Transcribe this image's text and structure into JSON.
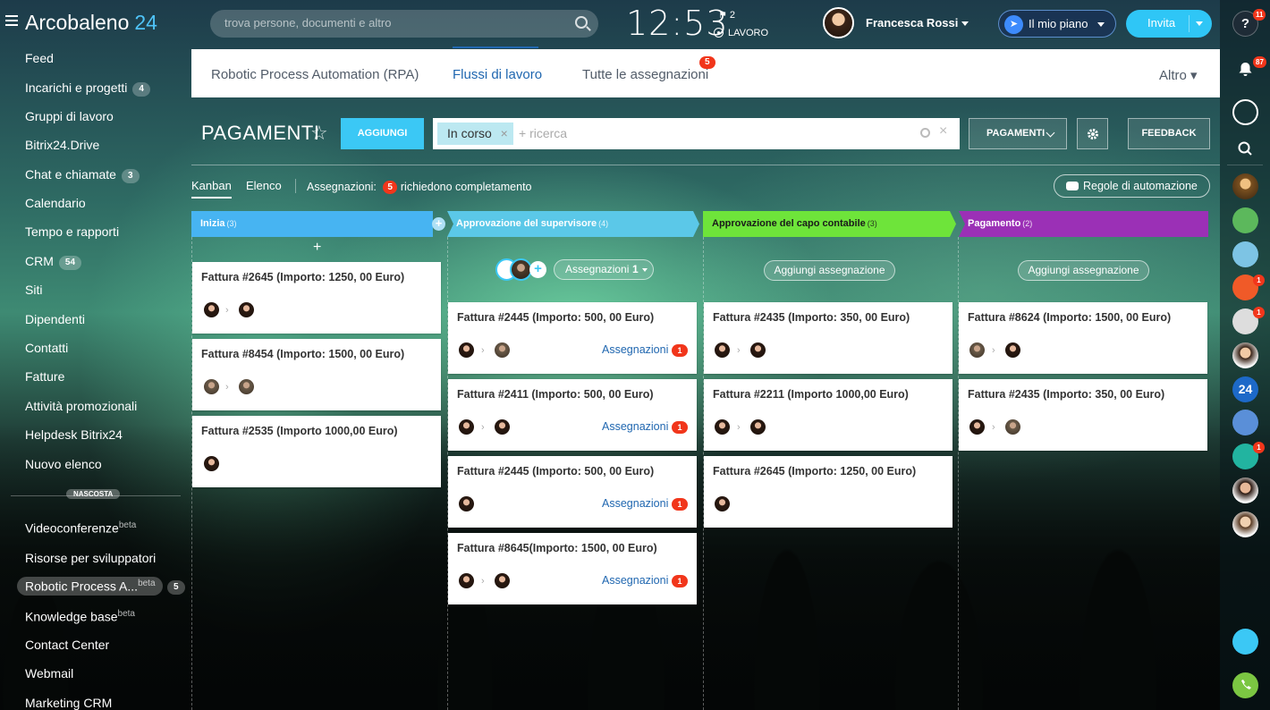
{
  "header": {
    "logo_text": "Arcobaleno",
    "logo_number": "24",
    "search_placeholder": "trova persone, documenti e altro",
    "clock": "12:53",
    "flag_count": "2",
    "work_status": "LAVORO",
    "user_name": "Francesca Rossi",
    "plan_label": "Il mio piano",
    "invite_label": "Invita"
  },
  "sidebar": {
    "items": [
      {
        "label": "Feed"
      },
      {
        "label": "Incarichi e progetti",
        "count": "4"
      },
      {
        "label": "Gruppi di lavoro"
      },
      {
        "label": "Bitrix24.Drive"
      },
      {
        "label": "Chat e chiamate",
        "count": "3"
      },
      {
        "label": "Calendario"
      },
      {
        "label": "Tempo e rapporti"
      },
      {
        "label": "CRM",
        "count": "54"
      },
      {
        "label": "Siti"
      },
      {
        "label": "Dipendenti"
      },
      {
        "label": "Contatti"
      },
      {
        "label": "Fatture"
      },
      {
        "label": "Attività promozionali"
      },
      {
        "label": "Helpdesk Bitrix24"
      },
      {
        "label": "Nuovo elenco"
      }
    ],
    "hidden_label": "NASCOSTA",
    "hidden_items": [
      {
        "label": "Videoconferenze",
        "sup": "beta"
      },
      {
        "label": "Risorse per sviluppatori"
      },
      {
        "label": "Robotic Process A...",
        "sup": "beta",
        "count": "5"
      },
      {
        "label": "Knowledge base",
        "sup": "beta"
      },
      {
        "label": "Contact Center"
      },
      {
        "label": "Webmail"
      },
      {
        "label": "Marketing CRM"
      }
    ]
  },
  "rail": {
    "help_badge": "11",
    "notif_badge": "87",
    "badges": [
      "1",
      "1",
      "1"
    ],
    "b24_label": "24"
  },
  "tabs": {
    "items": [
      "Robotic Process Automation (RPA)",
      "Flussi di lavoro",
      "Tutte le assegnazioni"
    ],
    "active": "Flussi di lavoro",
    "assignments_badge": "5",
    "more": "Altro"
  },
  "toolbar": {
    "title": "PAGAMENTI",
    "add_label": "AGGIUNGI",
    "filter_chip": "In corso",
    "filter_placeholder": "+ ricerca",
    "preset_label": "PAGAMENTI",
    "feedback_label": "FEEDBACK"
  },
  "views": {
    "kanban": "Kanban",
    "list": "Elenco",
    "assignments_prefix": "Assegnazioni:",
    "assignments_count": "5",
    "assignments_suffix": "richiedono completamento",
    "automation_label": "Regole di automazione"
  },
  "kanban": {
    "assign_link": "Assegnazioni",
    "add_assignment": "Aggiungi assegnazione",
    "supervisor_assign_label": "Assegnazioni",
    "supervisor_assign_count": "1",
    "columns": [
      {
        "title": "Inizia",
        "count": "(3)",
        "color": "#47b4f2",
        "cards": [
          {
            "title": "Fattura #2645 (Importo: 1250, 00 Euro)"
          },
          {
            "title": "Fattura #8454 (Importo: 1500, 00 Euro)"
          },
          {
            "title": "Fattura #2535 (Importo 1000,00 Euro)"
          }
        ]
      },
      {
        "title": "Approvazione del supervisore",
        "count": "(4)",
        "color": "#5bc8e8",
        "cards": [
          {
            "title": "Fattura #2445 (Importo: 500, 00 Euro)",
            "badge": "1"
          },
          {
            "title": "Fattura #2411 (Importo: 500, 00 Euro)",
            "badge": "1"
          },
          {
            "title": "Fattura #2445 (Importo: 500, 00 Euro)",
            "badge": "1"
          },
          {
            "title": "Fattura #8645(Importo: 1500, 00 Euro)",
            "badge": "1"
          }
        ]
      },
      {
        "title": "Approvazione del capo contabile",
        "count": "(3)",
        "color": "#6ee43a",
        "cards": [
          {
            "title": "Fattura #2435 (Importo: 350, 00 Euro)"
          },
          {
            "title": "Fattura #2211 (Importo 1000,00 Euro)"
          },
          {
            "title": "Fattura #2645 (Importo: 1250, 00 Euro)"
          }
        ]
      },
      {
        "title": "Pagamento",
        "count": "(2)",
        "color": "#9b30b6",
        "cards": [
          {
            "title": "Fattura #8624 (Importo: 1500, 00 Euro)"
          },
          {
            "title": "Fattura #2435 (Importo: 350, 00 Euro)"
          }
        ]
      }
    ]
  }
}
